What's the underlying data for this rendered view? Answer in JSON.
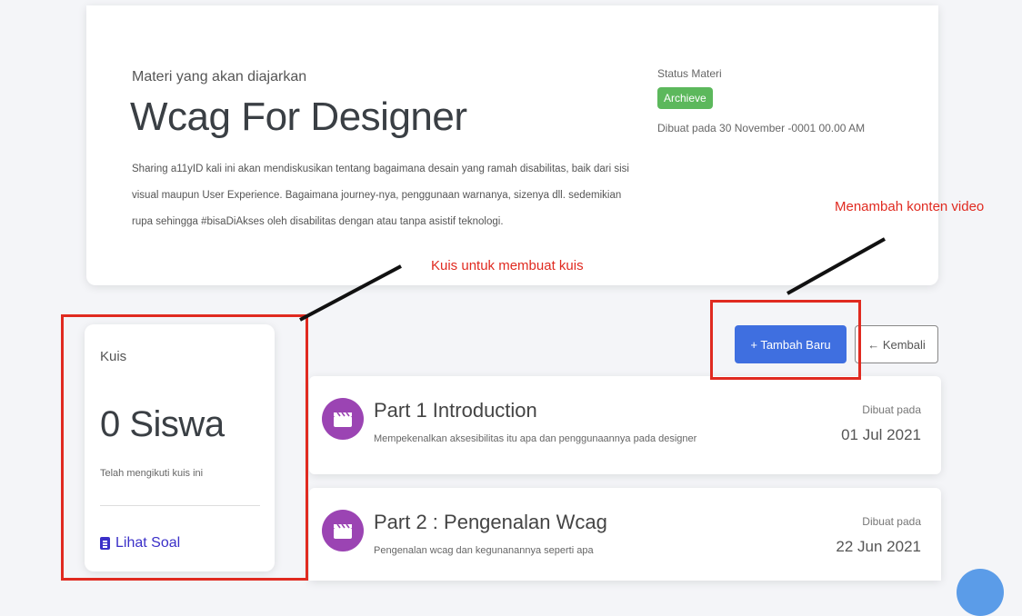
{
  "material": {
    "subtitle": "Materi yang akan diajarkan",
    "title": "Wcag For Designer",
    "description": "Sharing a11yID kali ini akan mendiskusikan tentang bagaimana desain yang ramah disabilitas, baik dari sisi visual maupun User Experience. Bagaimana journey-nya, penggunaan warnanya, sizenya dll. sedemikian rupa sehingga #bisaDiAkses oleh disabilitas dengan atau tanpa asistif teknologi.",
    "status_label": "Status Materi",
    "status_value": "Archieve",
    "created_text": "Dibuat pada 30 November -0001 00.00 AM"
  },
  "quiz": {
    "title": "Kuis",
    "count": "0 Siswa",
    "note": "Telah mengikuti kuis ini",
    "link_label": "Lihat Soal"
  },
  "actions": {
    "add_label": "+ Tambah Baru",
    "back_label": "← Kembali"
  },
  "videos": [
    {
      "title": "Part 1 Introduction",
      "description": "Mempekenalkan aksesibilitas itu apa dan penggunaannya pada designer",
      "created_label": "Dibuat pada",
      "created_date": "01 Jul 2021"
    },
    {
      "title": "Part 2 : Pengenalan Wcag",
      "description": "Pengenalan  wcag dan kegunanannya seperti apa",
      "created_label": "Dibuat pada",
      "created_date": "22 Jun 2021"
    }
  ],
  "annotations": {
    "video_note": "Menambah konten video",
    "quiz_note": "Kuis untuk membuat kuis"
  },
  "colors": {
    "accent": "#3f6fe0",
    "status": "#5cb85c",
    "video_icon": "#9b44b3",
    "annotation": "#e02a20",
    "link": "#3b30c8"
  },
  "icons": {
    "video": "clapperboard-icon",
    "quiz_link": "clipboard-icon"
  }
}
